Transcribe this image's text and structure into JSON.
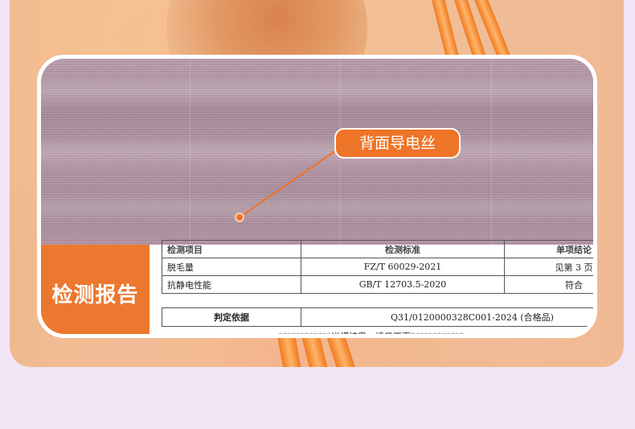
{
  "callout": {
    "label": "背面导电丝"
  },
  "report": {
    "label": "检测报告",
    "table_header": [
      "检测项目",
      "检测标准",
      "单项结论"
    ],
    "rows": [
      {
        "item": "脱毛量",
        "standard": "FZ/T 60029-2021",
        "result": "见第 3 页"
      },
      {
        "item": "抗静电性能",
        "standard": "GB/T 12703.5-2020",
        "result": "符合"
      }
    ],
    "basis_label": "判定依据",
    "basis_value": "Q31/0120000328C001-2024 (合格品)",
    "note": "************详细结果，请见下页************"
  },
  "colors": {
    "accent": "#ee7427",
    "background": "#f1e6f6",
    "fabric": "#ad8e9e"
  }
}
